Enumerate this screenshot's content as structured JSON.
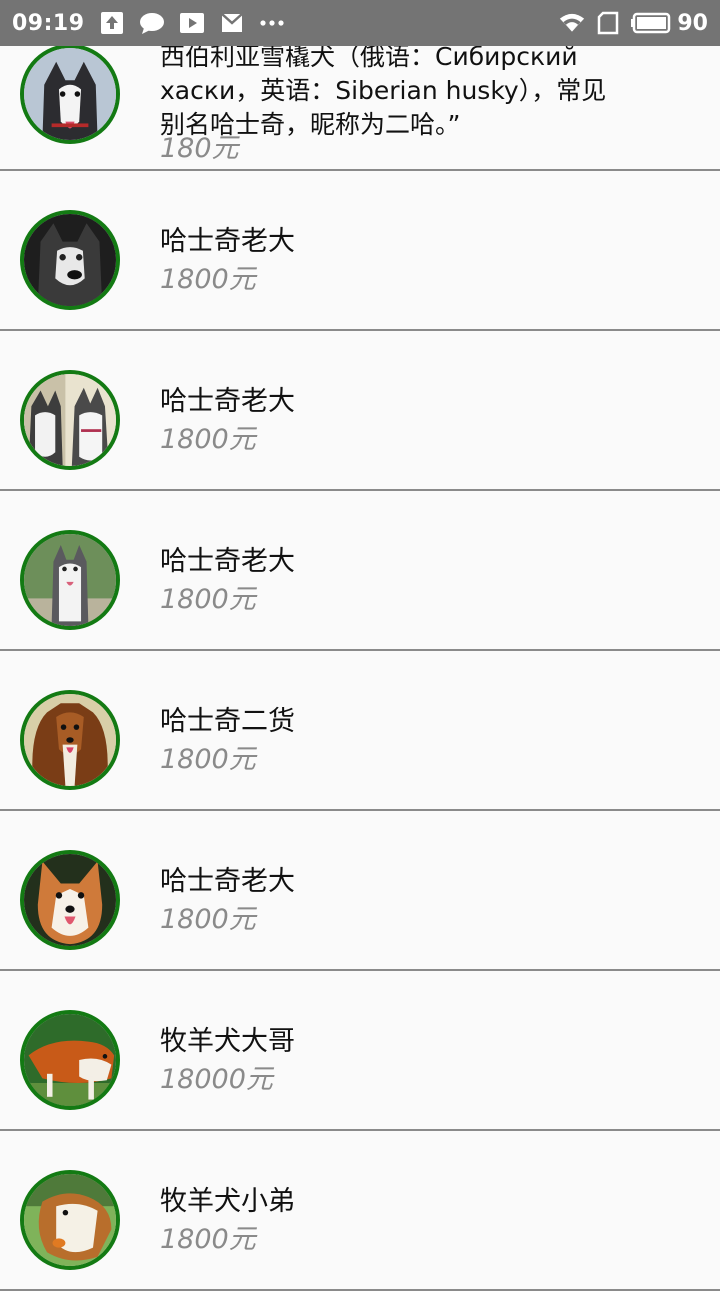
{
  "status_bar": {
    "time": "09:19",
    "battery": "90",
    "icons": [
      "upload-icon",
      "message-icon",
      "play-store-icon",
      "mail-icon",
      "more-icon",
      "wifi-icon",
      "sim-icon",
      "battery-icon"
    ]
  },
  "items": [
    {
      "description_lines": [
        "西伯利亚雪橇犬（俄语：Сибирский",
        "хаски，英语：Siberian husky），常见",
        "别名哈士奇，昵称为二哈。”"
      ],
      "price": "180元",
      "avatar": "husky-photo"
    },
    {
      "name": "哈士奇老大",
      "price": "1800元",
      "avatar": "husky-closeup-photo"
    },
    {
      "name": "哈士奇老大",
      "price": "1800元",
      "avatar": "two-huskies-photo"
    },
    {
      "name": "哈士奇老大",
      "price": "1800元",
      "avatar": "husky-standing-photo"
    },
    {
      "name": "哈士奇二货",
      "price": "1800元",
      "avatar": "collie-photo"
    },
    {
      "name": "哈士奇老大",
      "price": "1800元",
      "avatar": "corgi-photo"
    },
    {
      "name": "牧羊犬大哥",
      "price": "18000元",
      "avatar": "sheepdog-running-photo"
    },
    {
      "name": "牧羊犬小弟",
      "price": "1800元",
      "avatar": "collie-grass-photo"
    }
  ]
}
